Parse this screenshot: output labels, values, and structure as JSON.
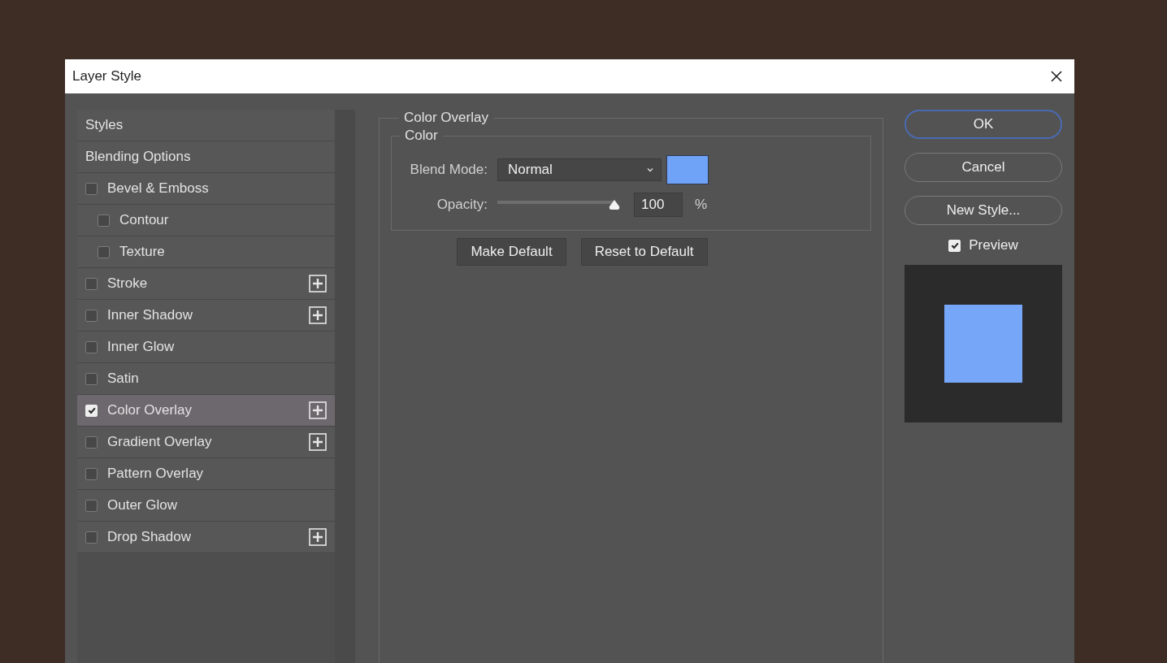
{
  "window": {
    "title": "Layer Style"
  },
  "styles_list": [
    {
      "kind": "header",
      "label": "Styles",
      "selected": false
    },
    {
      "kind": "header",
      "label": "Blending Options",
      "selected": false
    },
    {
      "kind": "effect",
      "label": "Bevel & Emboss",
      "checked": false,
      "selected": false,
      "addable": false,
      "children": [
        {
          "kind": "effect",
          "label": "Contour",
          "checked": false,
          "selected": false,
          "addable": false
        },
        {
          "kind": "effect",
          "label": "Texture",
          "checked": false,
          "selected": false,
          "addable": false
        }
      ]
    },
    {
      "kind": "effect",
      "label": "Stroke",
      "checked": false,
      "selected": false,
      "addable": true
    },
    {
      "kind": "effect",
      "label": "Inner Shadow",
      "checked": false,
      "selected": false,
      "addable": true
    },
    {
      "kind": "effect",
      "label": "Inner Glow",
      "checked": false,
      "selected": false,
      "addable": false
    },
    {
      "kind": "effect",
      "label": "Satin",
      "checked": false,
      "selected": false,
      "addable": false
    },
    {
      "kind": "effect",
      "label": "Color Overlay",
      "checked": true,
      "selected": true,
      "addable": true
    },
    {
      "kind": "effect",
      "label": "Gradient Overlay",
      "checked": false,
      "selected": false,
      "addable": true
    },
    {
      "kind": "effect",
      "label": "Pattern Overlay",
      "checked": false,
      "selected": false,
      "addable": false
    },
    {
      "kind": "effect",
      "label": "Outer Glow",
      "checked": false,
      "selected": false,
      "addable": false
    },
    {
      "kind": "effect",
      "label": "Drop Shadow",
      "checked": false,
      "selected": false,
      "addable": true
    }
  ],
  "panel": {
    "title": "Color Overlay",
    "group_title": "Color",
    "blend_mode": {
      "label": "Blend Mode:",
      "value": "Normal"
    },
    "opacity": {
      "label": "Opacity:",
      "level": 1.0,
      "value": "100",
      "unit": "%"
    },
    "buttons": [
      "Make Default",
      "Reset to Default"
    ]
  },
  "actions": [
    {
      "label": "OK",
      "default": true
    },
    {
      "label": "Cancel",
      "default": false
    },
    {
      "label": "New Style...",
      "default": false
    }
  ],
  "preview": {
    "label": "Preview",
    "checked": true
  }
}
